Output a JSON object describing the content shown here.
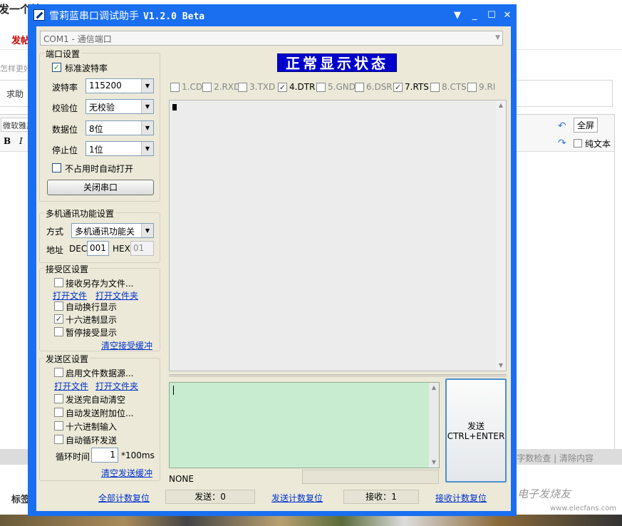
{
  "background_page": {
    "heading": "发一个帖子",
    "tab_label": "发帖",
    "hint_text": "怎样更好",
    "question_label": "求助",
    "font_name": "微软雅黑",
    "bold_label": "B",
    "italic_label": "I",
    "fullscreen_label": "全屏",
    "plain_text_label": "纯文本",
    "status_links": "字数检查 | 清除内容",
    "tags_label": "标签",
    "watermark": "电子发烧友",
    "watermark_url": "www.elecfans.com"
  },
  "window": {
    "title": "雪莉蓝串口调试助手",
    "version": "V1.2.0 Beta",
    "controls": [
      "▼",
      "_",
      "☐",
      "✕"
    ]
  },
  "port_combo": {
    "value": "COM1 - 通信端口",
    "arrow": "▼"
  },
  "port_settings": {
    "title": "端口设置",
    "standard_baud": {
      "label": "标准波特率",
      "checked": true
    },
    "baud": {
      "label": "波特率",
      "value": "115200"
    },
    "parity": {
      "label": "校验位",
      "value": "无校验"
    },
    "data_bits": {
      "label": "数据位",
      "value": "8位"
    },
    "stop_bits": {
      "label": "停止位",
      "value": "1位"
    },
    "auto_open": {
      "label": "不占用时自动打开",
      "checked": false
    },
    "close_button": "关闭串口"
  },
  "multi": {
    "title": "多机通讯功能设置",
    "mode_label": "方式",
    "mode_value": "多机通讯功能关",
    "addr_label": "地址",
    "dec_label": "DEC",
    "dec_value": "001",
    "hex_label": "HEX",
    "hex_value": "01"
  },
  "receive": {
    "title": "接受区设置",
    "save_to_file": {
      "label": "接收另存为文件...",
      "checked": false
    },
    "open_file": "打开文件",
    "open_folder": "打开文件夹",
    "auto_newline": {
      "label": "自动换行显示",
      "checked": false
    },
    "hex_display": {
      "label": "十六进制显示",
      "checked": true
    },
    "pause": {
      "label": "暂停接受显示",
      "checked": false
    },
    "clear": "清空接受缓冲"
  },
  "send": {
    "title": "发送区设置",
    "file_source": {
      "label": "启用文件数据源...",
      "checked": false
    },
    "open_file": "打开文件",
    "open_folder": "打开文件夹",
    "auto_clear": {
      "label": "发送完自动清空",
      "checked": false
    },
    "append_bits": {
      "label": "自动发送附加位...",
      "checked": false
    },
    "hex_input": {
      "label": "十六进制输入",
      "checked": false
    },
    "loop": {
      "label": "自动循环发送",
      "checked": false
    },
    "cycle_label": "循环时间",
    "cycle_value": "1",
    "cycle_unit": "*100ms",
    "clear": "清空发送缓冲"
  },
  "banner": "正常显示状态",
  "signals": [
    {
      "label": "1.CD",
      "checked": false
    },
    {
      "label": "2.RXD",
      "checked": false
    },
    {
      "label": "3.TXD",
      "checked": false
    },
    {
      "label": "4.DTR",
      "checked": true
    },
    {
      "label": "5.GND",
      "checked": false
    },
    {
      "label": "6.DSR",
      "checked": false
    },
    {
      "label": "7.RTS",
      "checked": true
    },
    {
      "label": "8.CTS",
      "checked": false
    },
    {
      "label": "9.RI",
      "checked": false
    }
  ],
  "send_button": {
    "line1": "发送",
    "line2": "CTRL+ENTER"
  },
  "status": "NONE",
  "footer": {
    "reset_all": "全部计数复位",
    "sent_label": "发送：",
    "sent_value": "0",
    "reset_sent": "发送计数复位",
    "recv_label": "接收：",
    "recv_value": "1",
    "reset_recv": "接收计数复位"
  }
}
